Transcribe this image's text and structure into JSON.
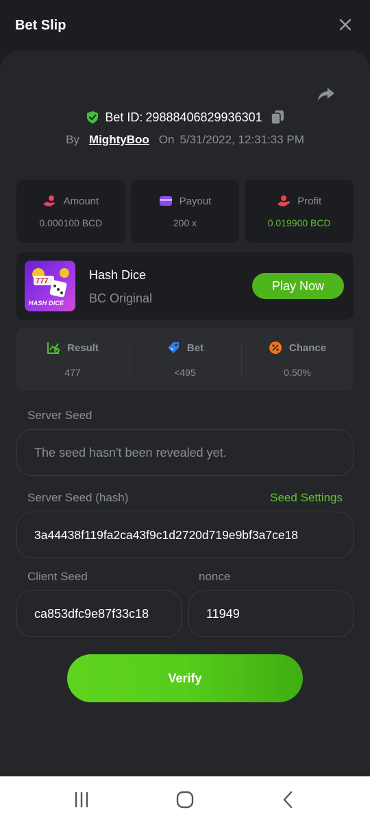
{
  "header": {
    "title": "Bet Slip"
  },
  "bet": {
    "id_label": "Bet ID:",
    "id": "29888406829936301",
    "by_label": "By",
    "username": "MightyBoo",
    "on_label": "On",
    "datetime": "5/31/2022, 12:31:33 PM"
  },
  "stats": {
    "amount": {
      "label": "Amount",
      "value": "0.000100 BCD"
    },
    "payout": {
      "label": "Payout",
      "value": "200 x"
    },
    "profit": {
      "label": "Profit",
      "value": "0.019900 BCD"
    }
  },
  "game": {
    "thumb_text": "HASH DICE",
    "name": "Hash Dice",
    "subtitle": "BC Original",
    "play_label": "Play Now"
  },
  "results": {
    "result": {
      "label": "Result",
      "value": "477"
    },
    "bet": {
      "label": "Bet",
      "value": "<495"
    },
    "chance": {
      "label": "Chance",
      "value": "0.50%"
    }
  },
  "seeds": {
    "server_seed_label": "Server Seed",
    "server_seed_value": "The seed hasn't been revealed yet.",
    "server_hash_label": "Server Seed (hash)",
    "seed_settings_label": "Seed Settings",
    "server_hash_value": "3a44438f119fa2ca43f9c1d2720d719e9bf3a7ce18",
    "client_seed_label": "Client Seed",
    "client_seed_value": "ca853dfc9e87f33c18",
    "nonce_label": "nonce",
    "nonce_value": "11949"
  },
  "verify_label": "Verify",
  "colors": {
    "background": "#1c1d20",
    "sheet": "#252629",
    "accent_green": "#5dc431",
    "muted_text": "#8b8e94"
  },
  "icons": {
    "close": "close-icon",
    "share": "share-icon",
    "shield": "shield-check-icon",
    "copy": "copy-icon",
    "amount": "coins-hand-icon",
    "payout": "card-icon",
    "profit": "hand-coin-icon",
    "result": "chart-check-icon",
    "bet": "tag-icon",
    "chance": "percent-icon",
    "nav_recent": "recent-apps-icon",
    "nav_home": "home-icon",
    "nav_back": "back-icon"
  }
}
